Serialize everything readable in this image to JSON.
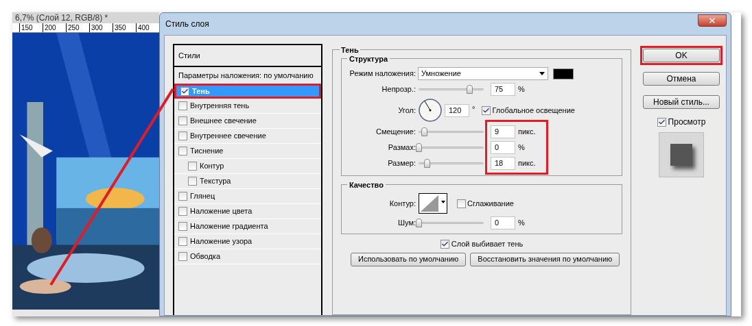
{
  "document": {
    "title": "6,7% (Слой 12, RGB/8) *",
    "ruler_ticks": [
      "150",
      "200",
      "250",
      "300",
      "350",
      "400"
    ]
  },
  "dialog": {
    "title": "Стиль слоя",
    "styles_header": "Стили",
    "styles": [
      {
        "kind": "header",
        "label": "Параметры наложения: по умолчанию",
        "selected": false
      },
      {
        "kind": "check",
        "label": "Тень",
        "checked": true,
        "selected": true,
        "highlighted": true
      },
      {
        "kind": "check",
        "label": "Внутренняя тень",
        "checked": false,
        "selected": false
      },
      {
        "kind": "check",
        "label": "Внешнее свечение",
        "checked": false,
        "selected": false
      },
      {
        "kind": "check",
        "label": "Внутреннее свечение",
        "checked": false,
        "selected": false
      },
      {
        "kind": "check",
        "label": "Тиснение",
        "checked": false,
        "selected": false,
        "children": [
          {
            "kind": "check",
            "label": "Контур",
            "checked": false,
            "selected": false
          },
          {
            "kind": "check",
            "label": "Текстура",
            "checked": false,
            "selected": false
          }
        ]
      },
      {
        "kind": "check",
        "label": "Глянец",
        "checked": false,
        "selected": false
      },
      {
        "kind": "check",
        "label": "Наложение цвета",
        "checked": false,
        "selected": false
      },
      {
        "kind": "check",
        "label": "Наложение градиента",
        "checked": false,
        "selected": false
      },
      {
        "kind": "check",
        "label": "Наложение узора",
        "checked": false,
        "selected": false
      },
      {
        "kind": "check",
        "label": "Обводка",
        "checked": false,
        "selected": false
      }
    ],
    "section_title": "Тень",
    "structure": {
      "title": "Структура",
      "rows": [
        {
          "kind": "blend",
          "label": "Режим наложения:",
          "value": "Умножение",
          "color": "#000000"
        },
        {
          "kind": "slider",
          "label": "Непрозр.:",
          "level": 0.78,
          "value": "75",
          "unit": "%",
          "highlighted": false
        },
        {
          "kind": "angle",
          "label": "Угол:",
          "value": "120",
          "unit": "°",
          "global_light": {
            "label": "Глобальное освещение",
            "checked": true
          }
        },
        {
          "kind": "slider",
          "label": "Смещение:",
          "level": 0.08,
          "value": "9",
          "unit": "пикс.",
          "highlighted": true
        },
        {
          "kind": "slider",
          "label": "Размах:",
          "level": 0,
          "value": "0",
          "unit": "%",
          "highlighted": true
        },
        {
          "kind": "slider",
          "label": "Размер:",
          "level": 0.13,
          "value": "18",
          "unit": "пикс.",
          "highlighted": true
        }
      ]
    },
    "quality": {
      "title": "Качество",
      "contour_label": "Контур:",
      "antialias": {
        "label": "Сглаживание",
        "checked": false
      },
      "noise": {
        "label": "Шум:",
        "level": 0,
        "value": "0",
        "unit": "%"
      }
    },
    "knockout": {
      "label": "Слой выбивает тень",
      "checked": true
    },
    "default_buttons": [
      "Использовать по умолчанию",
      "Восстановить значения по умолчанию"
    ],
    "buttons": [
      {
        "label": "OK",
        "highlighted": true
      },
      {
        "label": "Отмена",
        "highlighted": false
      },
      {
        "label": "Новый стиль...",
        "highlighted": false
      }
    ],
    "preview": {
      "label": "Просмотр",
      "checked": true
    }
  }
}
